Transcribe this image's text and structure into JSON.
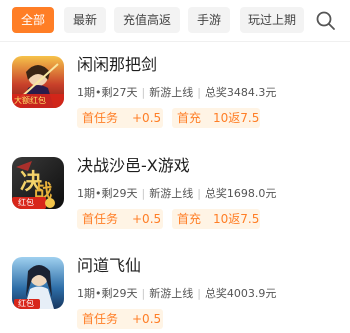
{
  "filters": [
    {
      "label": "全部",
      "active": true
    },
    {
      "label": "最新",
      "active": false
    },
    {
      "label": "充值高返",
      "active": false
    },
    {
      "label": "手游",
      "active": false
    },
    {
      "label": "玩过上期",
      "active": false
    }
  ],
  "search_icon": "search-icon",
  "colors": {
    "accent": "#ff7e26",
    "tag_bg": "#fff4e5",
    "chip_bg": "#f3f3f3"
  },
  "games": [
    {
      "title": "闲闲那把剑",
      "period": "1期",
      "remaining": "剩27天",
      "status": "新游上线",
      "prize": "总奖3484.3元",
      "icon_badge": "大额红包",
      "task_label": "首任务",
      "task_value": "+0.5",
      "rebate_label": "首充",
      "rebate_value": "10返7.5"
    },
    {
      "title": "决战沙邑-X游戏",
      "period": "1期",
      "remaining": "剩29天",
      "status": "新游上线",
      "prize": "总奖1698.0元",
      "icon_badge": "红包",
      "task_label": "首任务",
      "task_value": "+0.5",
      "rebate_label": "首充",
      "rebate_value": "10返7.5"
    },
    {
      "title": "问道飞仙",
      "period": "1期",
      "remaining": "剩29天",
      "status": "新游上线",
      "prize": "总奖4003.9元",
      "icon_badge": "红包",
      "task_label": "首任务",
      "task_value": "+0.5"
    }
  ]
}
